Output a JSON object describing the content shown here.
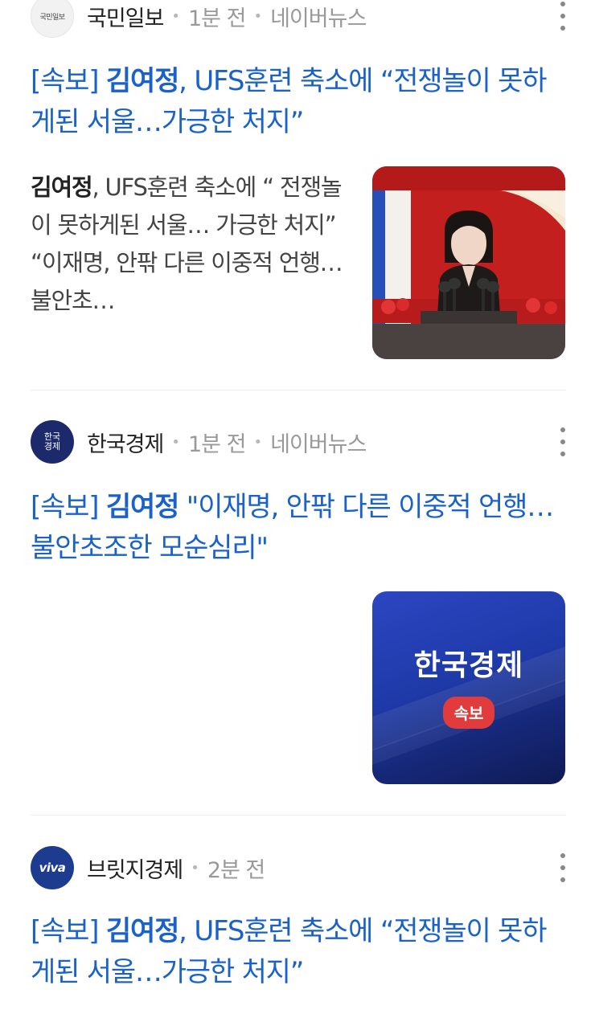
{
  "articles": [
    {
      "press": "국민일보",
      "press_logo_text": "국민일보",
      "time": "1분 전",
      "source": "네이버뉴스",
      "headline_prefix": "[속보] ",
      "headline_bold": "김여정",
      "headline_rest": ", UFS훈련 축소에 “전쟁놀이 못하게된 서울…가긍한 처지”",
      "summary_bold": "김여정",
      "summary_rest": ", UFS훈련 축소에 “ 전쟁놀이 못하게된 서울… 가긍한 처지” “이재명, 안팎 다른 이중적 언행…불안초…",
      "thumbnail": "speaker-at-podium-photo"
    },
    {
      "press": "한국경제",
      "press_logo_text": "한국 경제",
      "time": "1분 전",
      "source": "네이버뉴스",
      "headline_prefix": "[속보] ",
      "headline_bold": "김여정",
      "headline_rest": " \"이재명, 안팎 다른 이중적 언행…불안초조한 모순심리\"",
      "thumbnail_title": "한국경제",
      "thumbnail_badge": "속보"
    },
    {
      "press": "브릿지경제",
      "press_logo_text": "viva",
      "time": "2분 전",
      "headline_prefix": "[속보] ",
      "headline_bold": "김여정",
      "headline_rest": ", UFS훈련 축소에 “전쟁놀이 못하게된 서울…가긍한 처지”"
    }
  ],
  "colors": {
    "headline": "#1a62c9",
    "meta": "#999999",
    "badge": "#e23b3b"
  }
}
